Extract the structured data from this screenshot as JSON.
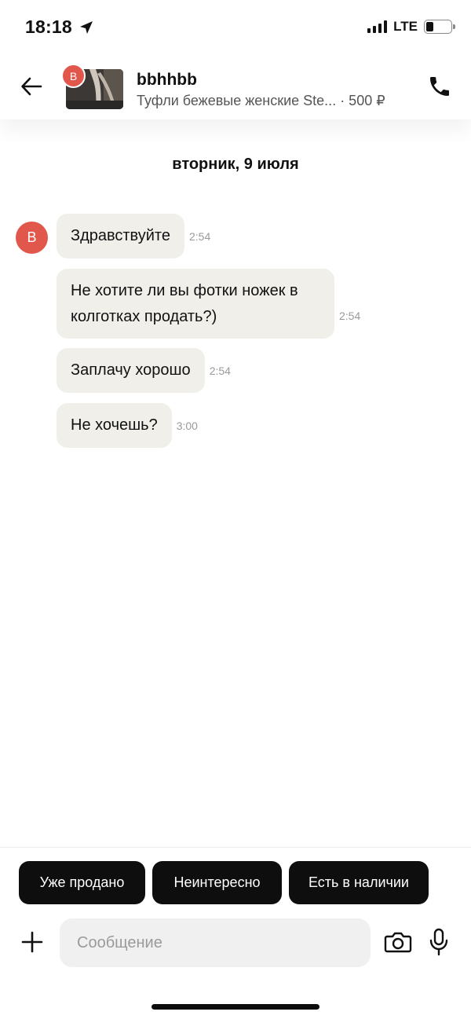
{
  "status_bar": {
    "time": "18:18",
    "network": "LTE",
    "icons": [
      "location-arrow-icon",
      "signal-icon",
      "battery-icon"
    ]
  },
  "header": {
    "back_icon": "arrow-left-icon",
    "seller_name": "bbhhbb",
    "avatar_letter": "B",
    "listing_title": "Туфли бежевые женские Ste... · 500 ₽",
    "call_icon": "phone-icon"
  },
  "chat": {
    "date": "вторник, 9 июля",
    "sender_avatar_letter": "B",
    "messages": [
      {
        "text": "Здравствуйте",
        "time": "2:54"
      },
      {
        "text": "Не хотите ли вы фотки ножек в колготках продать?)",
        "time": "2:54"
      },
      {
        "text": "Заплачу хорошо",
        "time": "2:54"
      },
      {
        "text": "Не хочешь?",
        "time": "3:00"
      }
    ]
  },
  "quick_replies": [
    "Уже продано",
    "Неинтересно",
    "Есть в наличии"
  ],
  "composer": {
    "placeholder": "Сообщение",
    "icons": [
      "plus-icon",
      "camera-icon",
      "microphone-icon"
    ]
  },
  "colors": {
    "avatar": "#e2574c",
    "bubble": "#f0efea",
    "chip": "#0e0e0e",
    "input_bg": "#f0f0f0"
  }
}
